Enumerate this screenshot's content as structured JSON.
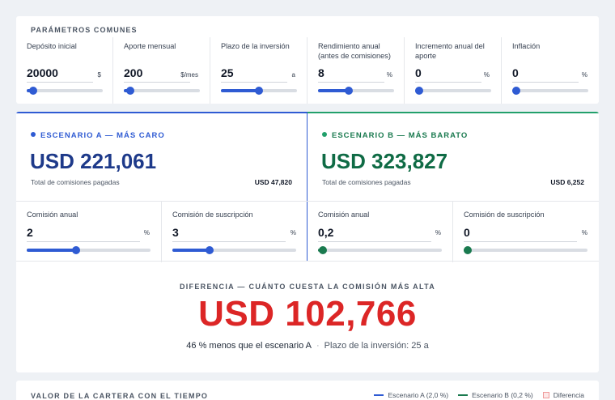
{
  "common": {
    "title": "PARÁMETROS COMUNES",
    "params": [
      {
        "label": "Depósito inicial",
        "value": "20000",
        "unit": "$",
        "fraction": 0.08
      },
      {
        "label": "Aporte mensual",
        "value": "200",
        "unit": "$/mes",
        "fraction": 0.08
      },
      {
        "label": "Plazo de la inversión",
        "value": "25",
        "unit": "a",
        "fraction": 0.5
      },
      {
        "label": "Rendimiento anual (antes de comisiones)",
        "value": "8",
        "unit": "%",
        "fraction": 0.4
      },
      {
        "label": "Incremento anual del aporte",
        "value": "0",
        "unit": "%",
        "fraction": 0.0
      },
      {
        "label": "Inflación",
        "value": "0",
        "unit": "%",
        "fraction": 0.0
      }
    ]
  },
  "scenario_a": {
    "title": "ESCENARIO A — MÁS CARO",
    "total": "USD 221,061",
    "fees_label": "Total de comisiones pagadas",
    "fees_value": "USD 47,820",
    "annual_fee": {
      "label": "Comisión anual",
      "value": "2",
      "unit": "%",
      "fraction": 0.4
    },
    "subscription_fee": {
      "label": "Comisión de suscripción",
      "value": "3",
      "unit": "%",
      "fraction": 0.3
    }
  },
  "scenario_b": {
    "title": "ESCENARIO B — MÁS BARATO",
    "total": "USD 323,827",
    "fees_label": "Total de comisiones pagadas",
    "fees_value": "USD 6,252",
    "annual_fee": {
      "label": "Comisión anual",
      "value": "0,2",
      "unit": "%",
      "fraction": 0.04
    },
    "subscription_fee": {
      "label": "Comisión de suscripción",
      "value": "0",
      "unit": "%",
      "fraction": 0.0
    }
  },
  "difference": {
    "title": "DIFERENCIA — CUÁNTO CUESTA LA COMISIÓN MÁS ALTA",
    "value": "USD 102,766",
    "sub_main": "46 % menos que el escenario A",
    "separator": "·",
    "sub_term": "Plazo de la inversión: 25 a"
  },
  "chart": {
    "title": "VALOR DE LA CARTERA CON EL TIEMPO",
    "legend": {
      "a": "Escenario A (2,0 %)",
      "b": "Escenario B (0,2 %)",
      "diff": "Diferencia"
    }
  },
  "colors": {
    "blue": "#2f5bd3",
    "green": "#1a7a4f",
    "red": "#dc2626"
  }
}
